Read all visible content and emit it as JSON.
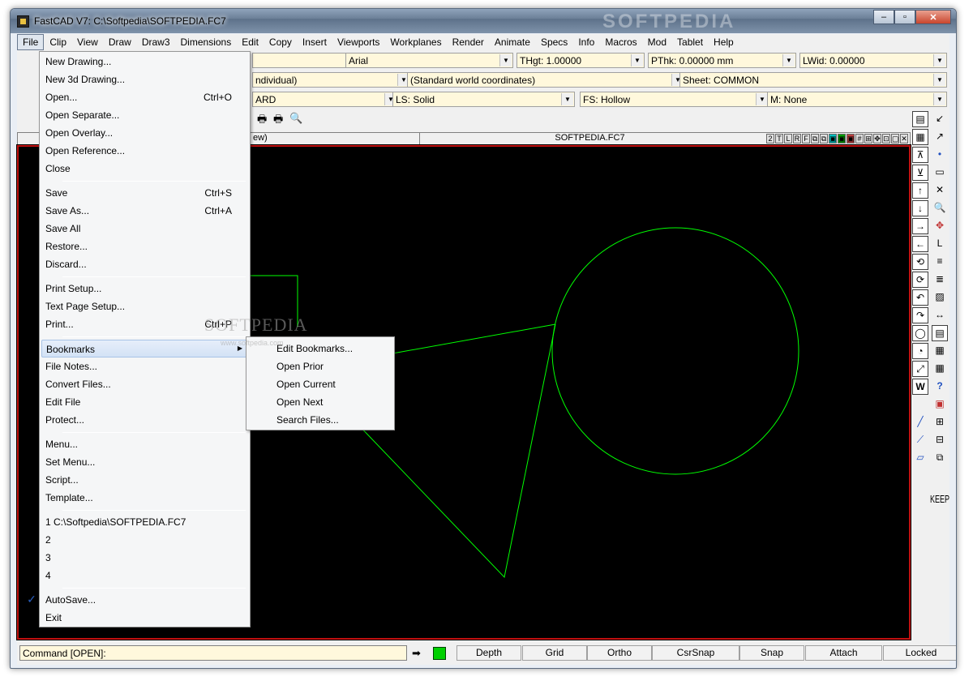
{
  "window": {
    "title": "FastCAD V7: C:\\Softpedia\\SOFTPEDIA.FC7",
    "watermark": "SOFTPEDIA",
    "minimize": "–",
    "maximize": "▫",
    "close": "✕"
  },
  "menubar": [
    "File",
    "Clip",
    "View",
    "Draw",
    "Draw3",
    "Dimensions",
    "Edit",
    "Copy",
    "Insert",
    "Viewports",
    "Workplanes",
    "Render",
    "Animate",
    "Specs",
    "Info",
    "Macros",
    "Mod",
    "Tablet",
    "Help"
  ],
  "toolbar": {
    "row1": {
      "font": "Arial",
      "thgt": "THgt: 1.00000",
      "pthk": "PThk: 0.00000 mm",
      "lwid": "LWid: 0.00000"
    },
    "row2": {
      "layer": "ndividual)",
      "coords": "(Standard world coordinates)",
      "sheet": "Sheet: COMMON"
    },
    "row3": {
      "color": "ARD",
      "ls": "LS: Solid",
      "fs": "FS: Hollow",
      "m": "M: None"
    }
  },
  "document": {
    "title": "SOFTPEDIA.FC7",
    "left_label": "ew)",
    "view_buttons": [
      "2",
      "T",
      "L",
      "R",
      "F",
      "⧉",
      "⧉",
      "▣",
      "▣",
      "▣",
      "#",
      "⊞",
      "✥",
      "⊡",
      "▢",
      "✕"
    ]
  },
  "right_tools": [
    "▤",
    "↙",
    "▦",
    "↗",
    "⊼",
    "•",
    "⊻",
    "▭",
    "↑",
    "✕",
    "↓",
    "🔍",
    "→",
    "✥",
    "←",
    "L",
    "⟲",
    "≡",
    "⟳",
    "≣",
    "↶",
    "▨",
    "↷",
    "↔",
    "◯",
    "▤",
    "◔",
    "▦",
    "⤢",
    "▦",
    "W",
    "?",
    "",
    "▣",
    "",
    "⊞",
    "",
    "⊟",
    "",
    "⧉",
    "KEEP"
  ],
  "file_menu": {
    "items": [
      {
        "label": "New Drawing...",
        "shortcut": ""
      },
      {
        "label": "New 3d Drawing...",
        "shortcut": ""
      },
      {
        "label": "Open...",
        "shortcut": "Ctrl+O"
      },
      {
        "label": "Open Separate...",
        "shortcut": ""
      },
      {
        "label": "Open Overlay...",
        "shortcut": ""
      },
      {
        "label": "Open Reference...",
        "shortcut": ""
      },
      {
        "label": "Close",
        "shortcut": ""
      },
      {
        "label": "Save",
        "shortcut": "Ctrl+S"
      },
      {
        "label": "Save As...",
        "shortcut": "Ctrl+A"
      },
      {
        "label": "Save All",
        "shortcut": ""
      },
      {
        "label": "Restore...",
        "shortcut": ""
      },
      {
        "label": "Discard...",
        "shortcut": ""
      },
      {
        "label": "Print Setup...",
        "shortcut": ""
      },
      {
        "label": "Text Page Setup...",
        "shortcut": ""
      },
      {
        "label": "Print...",
        "shortcut": "Ctrl+P"
      },
      {
        "label": "Bookmarks",
        "shortcut": ""
      },
      {
        "label": "File Notes...",
        "shortcut": ""
      },
      {
        "label": "Convert Files...",
        "shortcut": ""
      },
      {
        "label": "Edit File",
        "shortcut": ""
      },
      {
        "label": "Protect...",
        "shortcut": ""
      },
      {
        "label": "Menu...",
        "shortcut": ""
      },
      {
        "label": "Set Menu...",
        "shortcut": ""
      },
      {
        "label": "Script...",
        "shortcut": ""
      },
      {
        "label": "Template...",
        "shortcut": ""
      },
      {
        "label": "1 C:\\Softpedia\\SOFTPEDIA.FC7",
        "shortcut": ""
      },
      {
        "label": "2",
        "shortcut": ""
      },
      {
        "label": "3",
        "shortcut": ""
      },
      {
        "label": "4",
        "shortcut": ""
      },
      {
        "label": "AutoSave...",
        "shortcut": ""
      },
      {
        "label": "Exit",
        "shortcut": ""
      }
    ],
    "autosave_checked": true,
    "check_glyph": "✓",
    "submenu_arrow": "▶"
  },
  "bookmarks_submenu": [
    "Edit Bookmarks...",
    "Open Prior",
    "Open Current",
    "Open Next",
    "Search Files..."
  ],
  "watermarks": {
    "center": "SOFTPEDIA",
    "url": "www.softpedia.com"
  },
  "statusbar": {
    "command": "Command [OPEN]:",
    "buttons": [
      "Depth",
      "Grid",
      "Ortho",
      "CsrSnap",
      "Snap",
      "Attach",
      "Locked"
    ]
  },
  "colors": {
    "drawing_lines": "#00ff00",
    "canvas_bg": "#000000",
    "canvas_border": "#c01010",
    "input_bg": "#fff8dc"
  }
}
